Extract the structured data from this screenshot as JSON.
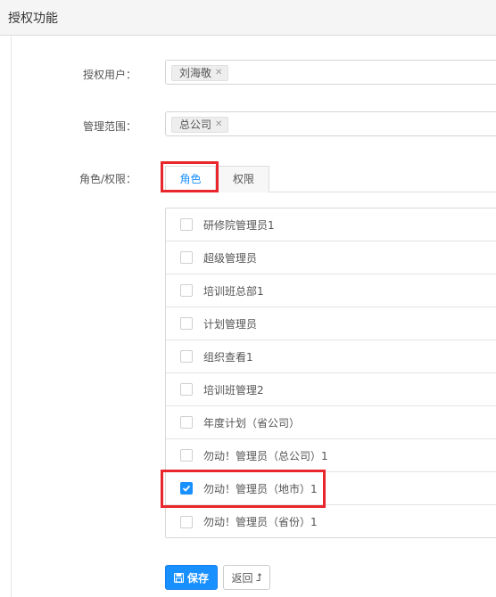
{
  "header": {
    "title": "授权功能"
  },
  "form": {
    "user_label": "授权用户：",
    "user_tag": "刘海敬",
    "scope_label": "管理范围：",
    "scope_tag": "总公司",
    "role_label": "角色/权限："
  },
  "tabs": [
    {
      "label": "角色",
      "active": true
    },
    {
      "label": "权限",
      "active": false
    }
  ],
  "roles": [
    {
      "label": "研修院管理员1",
      "checked": false
    },
    {
      "label": "超级管理员",
      "checked": false
    },
    {
      "label": "培训班总部1",
      "checked": false
    },
    {
      "label": "计划管理员",
      "checked": false
    },
    {
      "label": "组织查看1",
      "checked": false
    },
    {
      "label": "培训班管理2",
      "checked": false
    },
    {
      "label": "年度计划（省公司）",
      "checked": false
    },
    {
      "label": "勿动！管理员（总公司）1",
      "checked": false
    },
    {
      "label": "勿动！管理员（地市）1",
      "checked": true
    },
    {
      "label": "勿动！管理员（省份）1",
      "checked": false
    }
  ],
  "actions": {
    "save_label": "保存",
    "back_label": "返回"
  },
  "colors": {
    "primary": "#1890ff",
    "highlight": "#e8262b"
  }
}
